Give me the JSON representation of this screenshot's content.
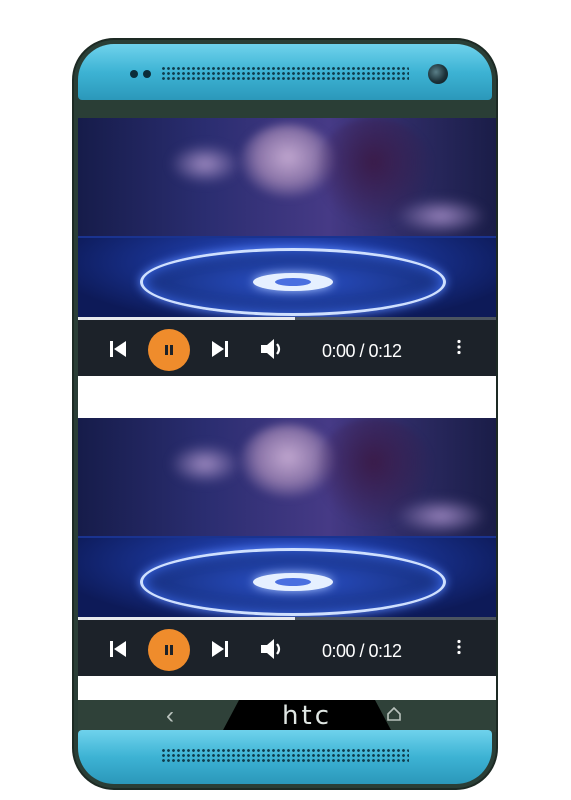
{
  "device": {
    "brand": "htc",
    "bezel_color": "#3db3d4",
    "nav": {
      "back_icon": "chevron-left-icon",
      "home_icon": "home-icon"
    }
  },
  "players": [
    {
      "poster": "dj-woman-turntable-image",
      "progress": 0.52,
      "time_display": "0:00 / 0:12",
      "state": "playing",
      "accent_color": "#ef8c2c",
      "icons": [
        "skip-previous-icon",
        "pause-icon",
        "skip-next-icon",
        "volume-icon",
        "more-vertical-icon"
      ]
    },
    {
      "poster": "dj-woman-turntable-image",
      "progress": 0.52,
      "time_display": "0:00 / 0:12",
      "state": "playing",
      "accent_color": "#ef8c2c",
      "icons": [
        "skip-previous-icon",
        "pause-icon",
        "skip-next-icon",
        "volume-icon",
        "more-vertical-icon"
      ]
    }
  ]
}
